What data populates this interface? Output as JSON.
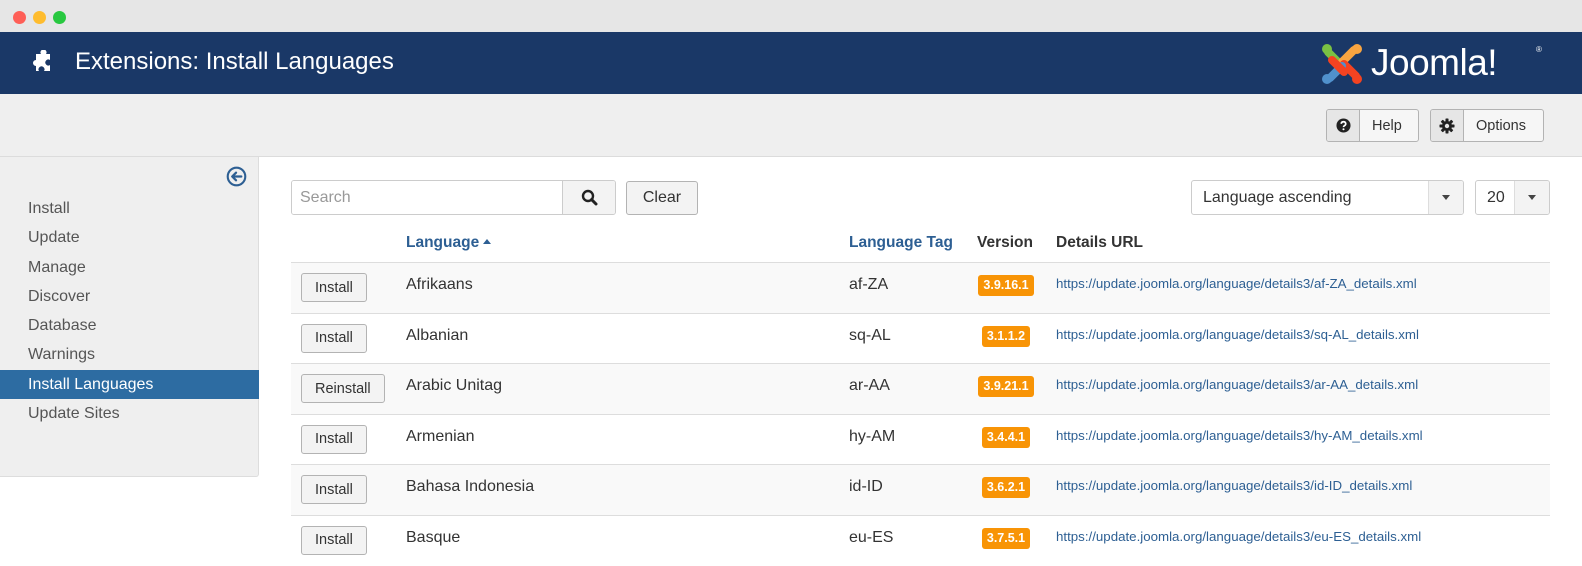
{
  "window": {
    "controls": [
      "close",
      "minimize",
      "maximize"
    ]
  },
  "header": {
    "icon": "puzzle-icon",
    "title": "Extensions: Install Languages",
    "logo_text": "Joomla!",
    "logo_reg": "®",
    "logo_colors": [
      "#7ac143",
      "#f9a541",
      "#f44321",
      "#5091cd"
    ]
  },
  "toolbar": {
    "help_label": "Help",
    "help_icon": "question-circle-icon",
    "options_label": "Options",
    "options_icon": "gear-icon"
  },
  "sidebar": {
    "collapse_icon": "arrow-circle-left-icon",
    "items": [
      {
        "label": "Install",
        "active": false
      },
      {
        "label": "Update",
        "active": false
      },
      {
        "label": "Manage",
        "active": false
      },
      {
        "label": "Discover",
        "active": false
      },
      {
        "label": "Database",
        "active": false
      },
      {
        "label": "Warnings",
        "active": false
      },
      {
        "label": "Install Languages",
        "active": true
      },
      {
        "label": "Update Sites",
        "active": false
      }
    ]
  },
  "filters": {
    "search_placeholder": "Search",
    "search_value": "",
    "clear_label": "Clear",
    "ordering_selected": "Language ascending",
    "limit_selected": "20"
  },
  "table": {
    "columns": {
      "language": "Language",
      "language_tag": "Language Tag",
      "version": "Version",
      "details_url": "Details URL"
    },
    "sort": {
      "column": "language",
      "direction": "ascending"
    },
    "rows": [
      {
        "action": "Install",
        "language": "Afrikaans",
        "tag": "af-ZA",
        "version": "3.9.16.1",
        "url": "https://update.joomla.org/language/details3/af-ZA_details.xml"
      },
      {
        "action": "Install",
        "language": "Albanian",
        "tag": "sq-AL",
        "version": "3.1.1.2",
        "url": "https://update.joomla.org/language/details3/sq-AL_details.xml"
      },
      {
        "action": "Reinstall",
        "language": "Arabic Unitag",
        "tag": "ar-AA",
        "version": "3.9.21.1",
        "url": "https://update.joomla.org/language/details3/ar-AA_details.xml"
      },
      {
        "action": "Install",
        "language": "Armenian",
        "tag": "hy-AM",
        "version": "3.4.4.1",
        "url": "https://update.joomla.org/language/details3/hy-AM_details.xml"
      },
      {
        "action": "Install",
        "language": "Bahasa Indonesia",
        "tag": "id-ID",
        "version": "3.6.2.1",
        "url": "https://update.joomla.org/language/details3/id-ID_details.xml"
      },
      {
        "action": "Install",
        "language": "Basque",
        "tag": "eu-ES",
        "version": "3.7.5.1",
        "url": "https://update.joomla.org/language/details3/eu-ES_details.xml"
      }
    ]
  },
  "colors": {
    "header_bg": "#1a3867",
    "active_nav": "#2d6ca2",
    "link": "#2d5f93",
    "version_badge": "#f89406"
  }
}
